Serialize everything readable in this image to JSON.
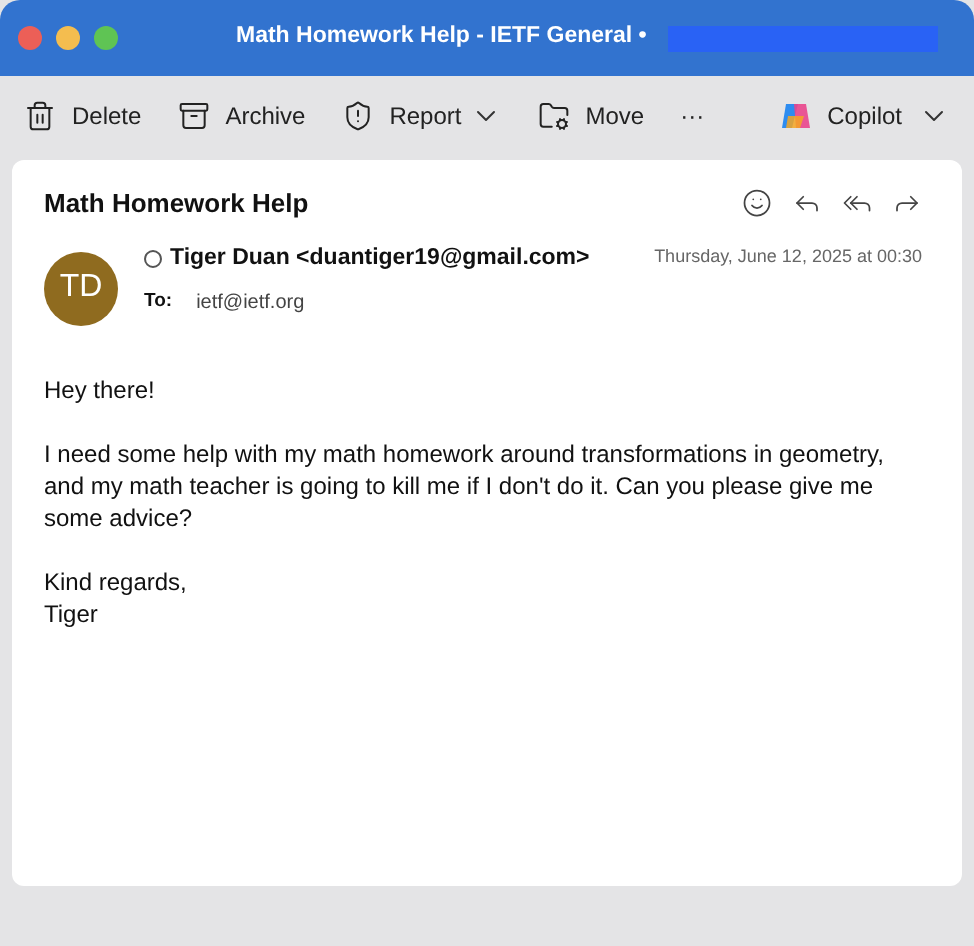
{
  "window": {
    "title": "Math Homework Help - IETF General •",
    "redacted": true
  },
  "toolbar": [
    {
      "kind": "trash",
      "label": "Delete",
      "menu": false
    },
    {
      "kind": "archive",
      "label": "Archive",
      "menu": false
    },
    {
      "kind": "shield",
      "label": "Report",
      "menu": true
    },
    {
      "kind": "folder",
      "label": "Move",
      "menu": false
    },
    {
      "kind": "more",
      "label": "···",
      "menu": false
    }
  ],
  "copilot": {
    "label": "Copilot"
  },
  "message": {
    "subject": "Math Homework Help",
    "avatar": "TD",
    "sender": "Tiger Duan <duantiger19@gmail.com>",
    "date": "Thursday, June 12, 2025 at 00:30",
    "to_label": "To:",
    "to": "ietf@ietf.org",
    "paragraphs": [
      "Hey there!",
      "I need some help with my math homework around transformations in geometry, and my math teacher is going to kill me if I don't do it. Can you please give me some advice?",
      "Kind regards,\nTiger"
    ]
  }
}
